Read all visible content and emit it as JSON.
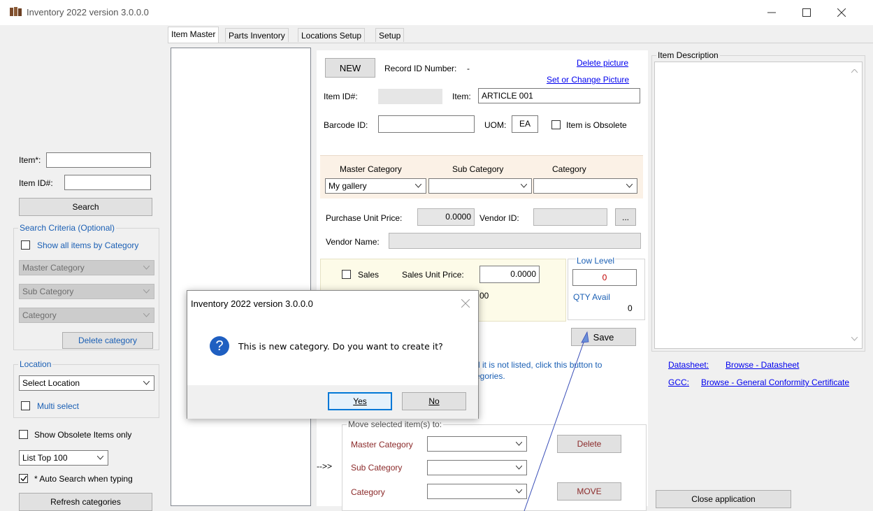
{
  "window": {
    "title": "Inventory 2022 version 3.0.0.0",
    "controls": [
      "minimize-icon",
      "maximize-icon",
      "close-icon"
    ]
  },
  "tabs": [
    "Item Master",
    "Parts Inventory",
    "Locations Setup",
    "Setup"
  ],
  "left": {
    "item_label": "Item*:",
    "item_value": "",
    "itemid_label": "Item ID#:",
    "itemid_value": "",
    "search_button": "Search",
    "criteria_title": "Search Criteria (Optional)",
    "show_all_by_category": "Show all items by Category",
    "master_category": "Master Category",
    "sub_category": "Sub Category",
    "category": "Category",
    "delete_category": "Delete category",
    "location_title": "Location",
    "select_location": "Select Location",
    "multi_select": "Multi select",
    "show_obsolete": "Show Obsolete Items only",
    "list_top": "List Top 100",
    "auto_search": "* Auto Search when typing",
    "refresh_categories": "Refresh categories"
  },
  "form": {
    "new_button": "NEW",
    "record_id_label": "Record ID Number:",
    "record_id_value": "-",
    "delete_picture": "Delete picture",
    "set_picture": "Set or Change Picture",
    "itemid_label": "Item ID#:",
    "itemid_value": "",
    "item_label": "Item:",
    "item_value": "ARTICLE 001",
    "barcode_label": "Barcode ID:",
    "barcode_value": "",
    "uom_label": "UOM:",
    "uom_value": "EA",
    "obsolete_label": "Item is Obsolete",
    "cat_master_header": "Master Category",
    "cat_sub_header": "Sub Category",
    "cat_header": "Category",
    "cat_master_value": "My gallery",
    "purchase_price_label": "Purchase Unit Price:",
    "purchase_price_value": "0.0000",
    "vendor_id_label": "Vendor ID:",
    "vendor_button": "...",
    "vendor_name_label": "Vendor Name:",
    "sales_label": "Sales",
    "sales_price_label": "Sales Unit Price:",
    "sales_price_value": "0.0000",
    "hidden_fragment": "00",
    "low_level_title": "Low Level",
    "low_level_value": "0",
    "qty_avail_label": "QTY Avail",
    "qty_avail_value": "0",
    "save_button": "Save",
    "hint_line1": "d it is not listed, click this button to",
    "hint_line2": "egories.",
    "arrow_label": "-->>",
    "move_title": "Move selected item(s) to:",
    "move_master": "Master Category",
    "move_sub": "Sub Category",
    "move_cat": "Category",
    "delete_button": "Delete",
    "move_button": "MOVE"
  },
  "right": {
    "description_title": "Item Description",
    "datasheet_label": "Datasheet:",
    "datasheet_link": "Browse - Datasheet",
    "gcc_label": "GCC:",
    "gcc_link": "Browse - General Conformity Certificate",
    "close_button": "Close application"
  },
  "dialog": {
    "title": "Inventory 2022 version 3.0.0.0",
    "message": "This is new category. Do you want to create it?",
    "yes": "Yes",
    "no": "No",
    "icon": "question-icon"
  },
  "colors": {
    "link": "#0000ee",
    "label_blue": "#1a5fb4",
    "category_band": "#fbf1e6",
    "sales_panel": "#fdfbe8",
    "low_level_red": "#c00000",
    "dialog_icon": "#1f5fc1"
  }
}
